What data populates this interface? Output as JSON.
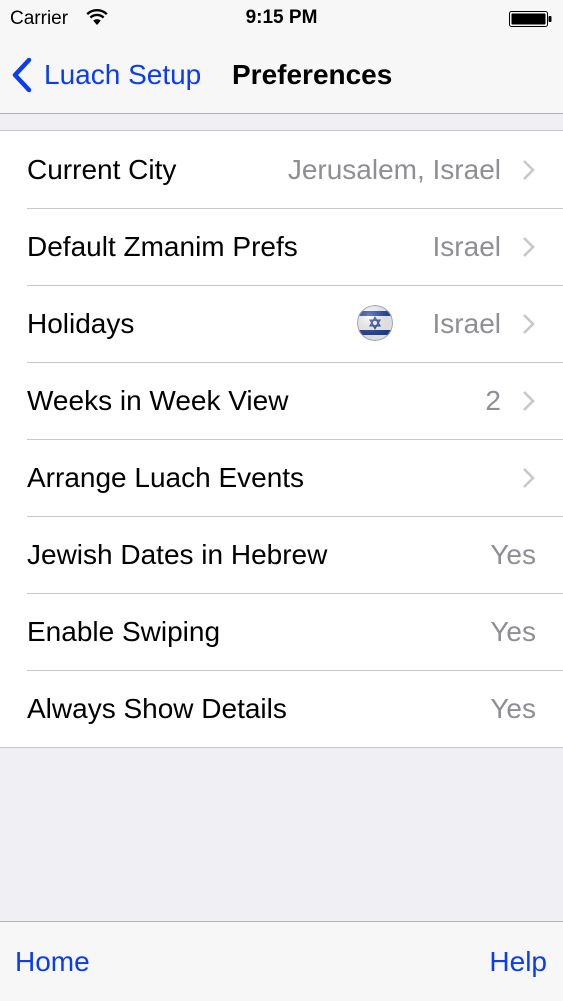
{
  "status_bar": {
    "carrier": "Carrier",
    "time": "9:15 PM"
  },
  "nav": {
    "back_label": "Luach Setup",
    "title": "Preferences"
  },
  "rows": [
    {
      "label": "Current City",
      "value": "Jerusalem, Israel",
      "chevron": true
    },
    {
      "label": "Default Zmanim Prefs",
      "value": "Israel",
      "chevron": true
    },
    {
      "label": "Holidays",
      "value": "Israel",
      "chevron": true,
      "icon": "israel-flag-icon"
    },
    {
      "label": "Weeks in Week View",
      "value": "2",
      "chevron": true
    },
    {
      "label": "Arrange Luach Events",
      "value": "",
      "chevron": true
    },
    {
      "label": "Jewish Dates in Hebrew",
      "value": "Yes",
      "chevron": false
    },
    {
      "label": "Enable Swiping",
      "value": "Yes",
      "chevron": false
    },
    {
      "label": "Always Show Details",
      "value": "Yes",
      "chevron": false
    }
  ],
  "toolbar": {
    "home_label": "Home",
    "help_label": "Help"
  },
  "colors": {
    "tint": "#0a3cf2",
    "secondary_text": "#8e8e93",
    "background": "#efeff4"
  }
}
